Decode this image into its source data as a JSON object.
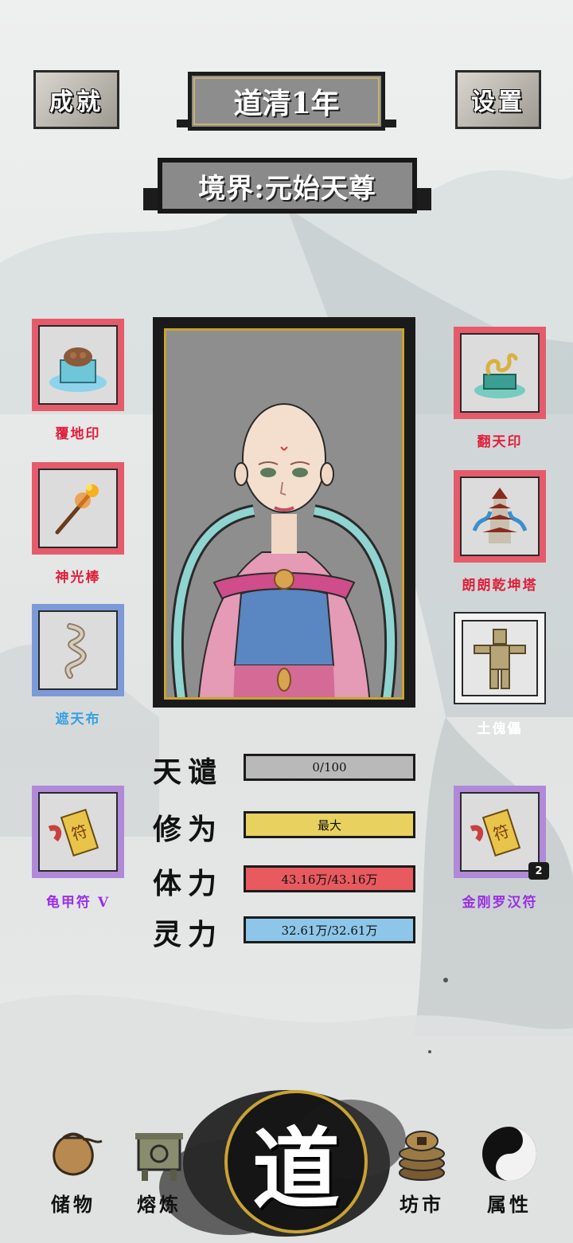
{
  "header": {
    "achievements_label": "成就",
    "settings_label": "设置",
    "year": "道清1年",
    "realm": "境界:元始天尊"
  },
  "portrait": {
    "character_name": ""
  },
  "left_slots": [
    {
      "label": "覆地印",
      "color": "#e0203a"
    },
    {
      "label": "神光棒",
      "color": "#e0203a"
    },
    {
      "label": "遮天布",
      "color": "#3aa0e0"
    },
    {
      "label": "龟甲符 V",
      "color": "#9a2ee6"
    }
  ],
  "right_slots": [
    {
      "label": "翻天印",
      "color": "#e0203a"
    },
    {
      "label": "朗朗乾坤塔",
      "color": "#e0203a"
    },
    {
      "label": "土傀儡",
      "color": "#ffffff"
    },
    {
      "label": "金刚罗汉符",
      "color": "#9a2ee6",
      "count": "2"
    }
  ],
  "stats": {
    "tianqian": {
      "label": "天谴",
      "value": "0/100",
      "fraction": 0,
      "color": "#8a8a8a"
    },
    "xiuwei": {
      "label": "修为",
      "value": "最大",
      "fraction": 1,
      "color": "#e8d15e"
    },
    "tili": {
      "label": "体力",
      "value": "43.16万/43.16万",
      "fraction": 1,
      "color": "#e85a5f"
    },
    "lingli": {
      "label": "灵力",
      "value": "32.61万/32.61万",
      "fraction": 1,
      "color": "#8ec6ea"
    }
  },
  "nav": {
    "storage": "储物",
    "smelt": "熔炼",
    "center": "道",
    "market": "坊市",
    "attributes": "属性"
  }
}
